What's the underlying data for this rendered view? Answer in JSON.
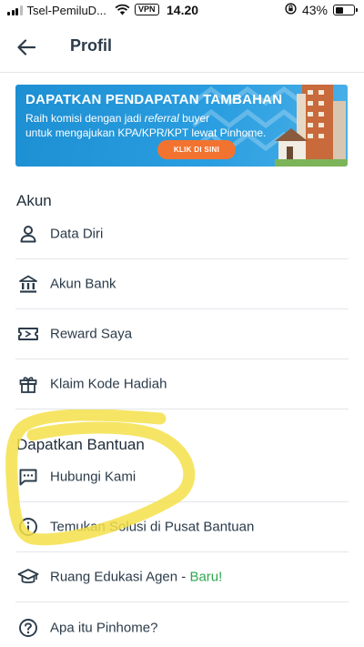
{
  "status_bar": {
    "carrier": "Tsel-PemiluD...",
    "vpn": "VPN",
    "time": "14.20",
    "battery_percent": "43%",
    "battery_level": 0.43
  },
  "header": {
    "title": "Profil"
  },
  "banner": {
    "headline": "DAPATKAN PENDAPATAN TAMBAHAN",
    "body_pre": "Raih komisi dengan jadi ",
    "body_italic": "referral",
    "body_post": " buyer",
    "body_line2": "untuk mengajukan KPA/KPR/KPT lewat Pinhome.",
    "cta": "KLIK DI SINI",
    "accent": "#f2732f",
    "bg": "#1d8fd3"
  },
  "sections": {
    "akun": {
      "title": "Akun",
      "items": [
        {
          "label": "Data Diri",
          "icon": "person-icon"
        },
        {
          "label": "Akun Bank",
          "icon": "bank-icon"
        },
        {
          "label": "Reward Saya",
          "icon": "ticket-icon"
        },
        {
          "label": "Klaim Kode Hadiah",
          "icon": "gift-icon"
        }
      ]
    },
    "bantuan": {
      "title": "Dapatkan Bantuan",
      "items": [
        {
          "label": "Hubungi Kami",
          "icon": "chat-icon"
        },
        {
          "label": "Temukan Solusi di Pusat Bantuan",
          "icon": "info-icon"
        },
        {
          "label": "Ruang Edukasi Agen - ",
          "badge": "Baru!",
          "icon": "graduation-cap-icon"
        },
        {
          "label": "Apa itu Pinhome?",
          "icon": "help-icon"
        }
      ]
    }
  },
  "colors": {
    "text": "#1f2d3a",
    "badge_green": "#2fa84f",
    "highlight": "#f4e04a"
  }
}
